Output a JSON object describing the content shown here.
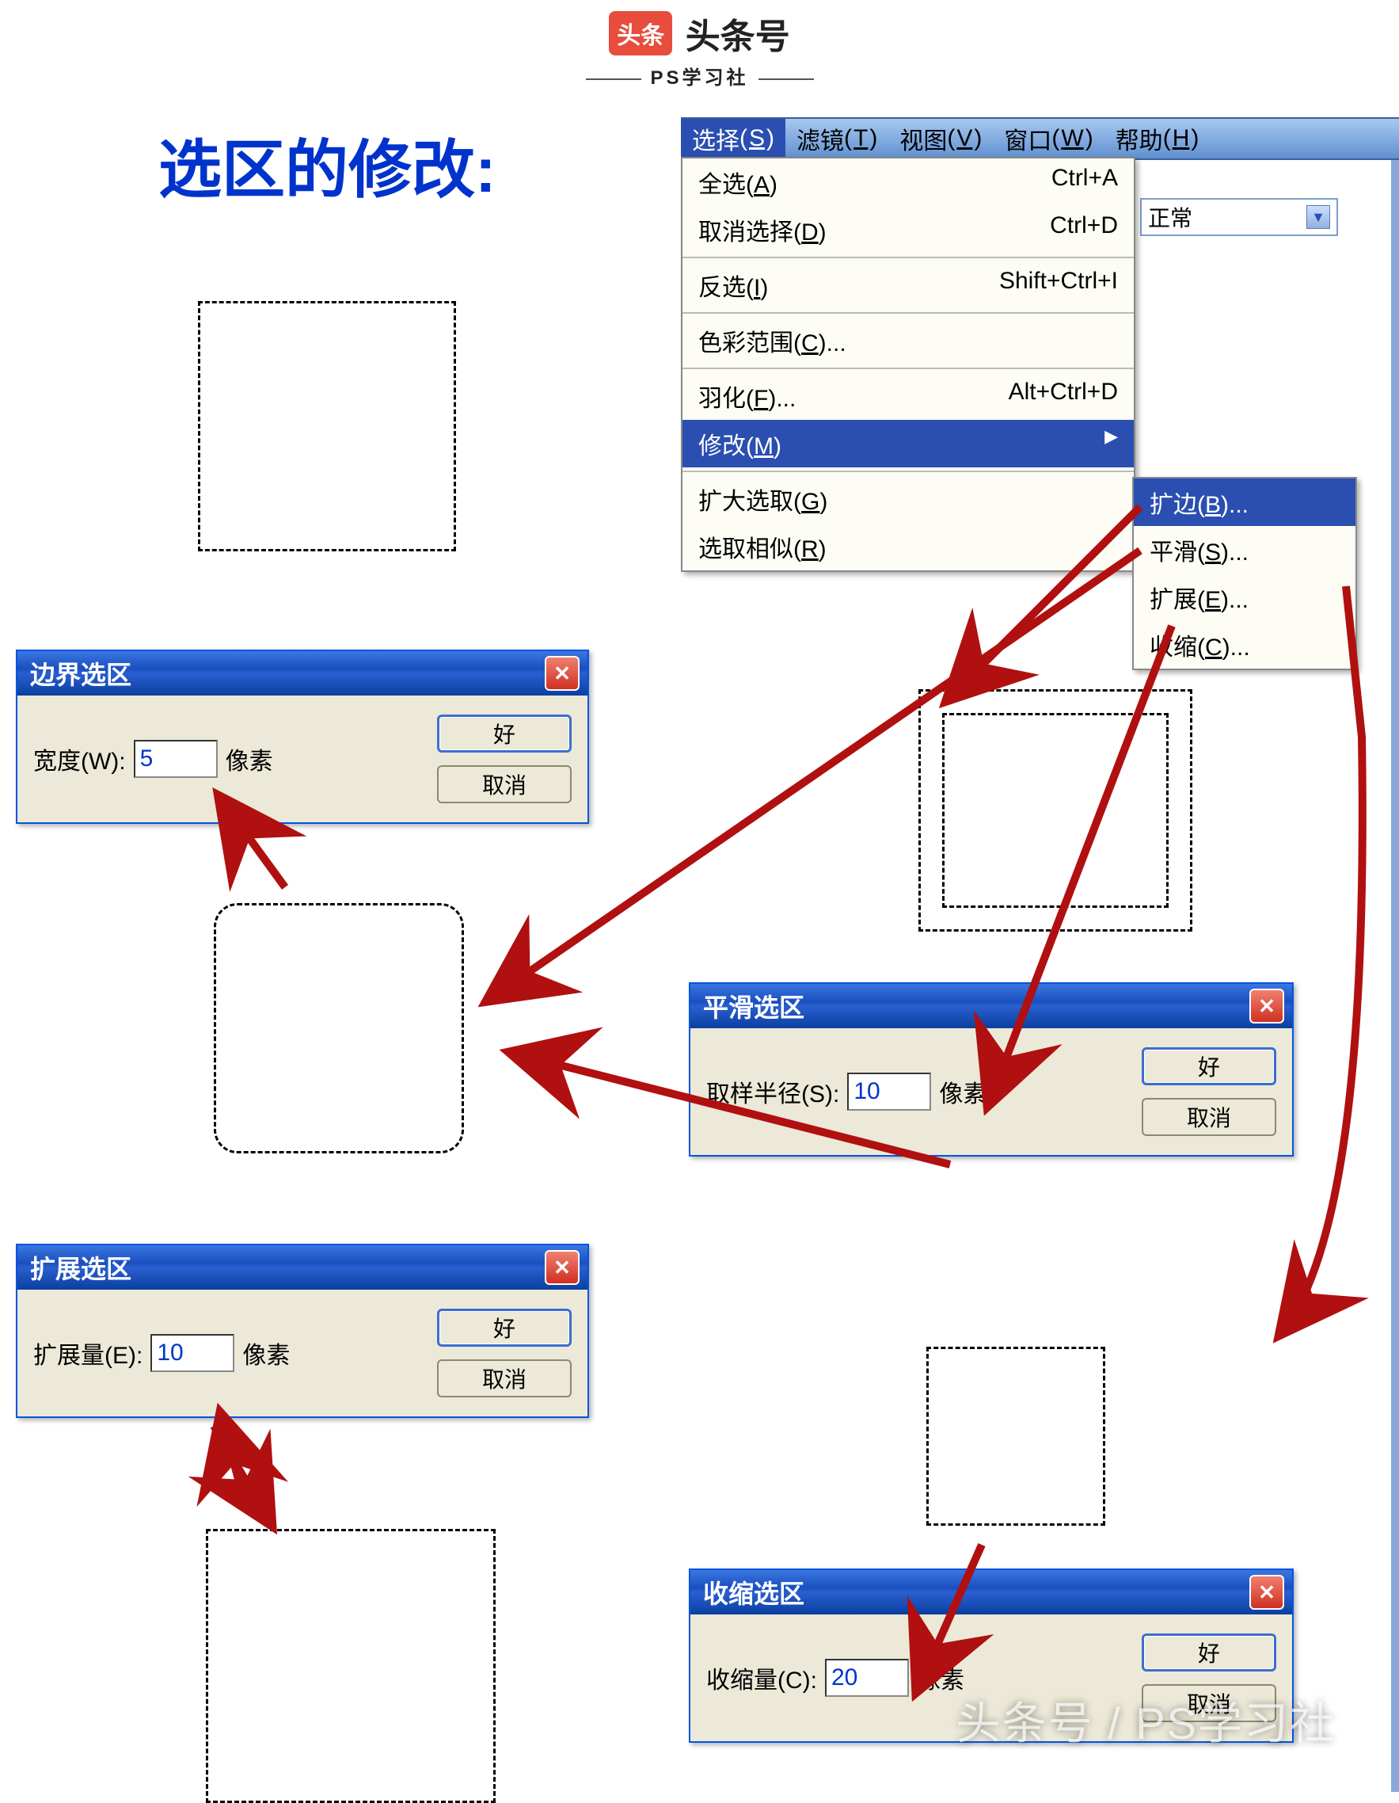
{
  "logo": {
    "badge": "头条",
    "text": "头条号",
    "sub": "PS学习社"
  },
  "page_title": "选区的修改:",
  "menubar": {
    "items": [
      {
        "label": "选择",
        "key": "S",
        "selected": true
      },
      {
        "label": "滤镜",
        "key": "T"
      },
      {
        "label": "视图",
        "key": "V"
      },
      {
        "label": "窗口",
        "key": "W"
      },
      {
        "label": "帮助",
        "key": "H"
      }
    ]
  },
  "tool_dropdown": {
    "value": "正常"
  },
  "dropdown": {
    "rows": [
      {
        "label": "全选",
        "key": "A",
        "shortcut": "Ctrl+A"
      },
      {
        "label": "取消选择",
        "key": "D",
        "shortcut": "Ctrl+D"
      },
      {
        "sep": true
      },
      {
        "label": "反选",
        "key": "I",
        "shortcut": "Shift+Ctrl+I"
      },
      {
        "sep": true
      },
      {
        "label": "色彩范围",
        "key": "C",
        "suffix": "..."
      },
      {
        "sep": true
      },
      {
        "label": "羽化",
        "key": "F",
        "suffix": "...",
        "shortcut": "Alt+Ctrl+D"
      },
      {
        "label": "修改",
        "key": "M",
        "selected": true,
        "arrow": true
      },
      {
        "sep": true
      },
      {
        "label": "扩大选取",
        "key": "G"
      },
      {
        "label": "选取相似",
        "key": "R"
      }
    ]
  },
  "submenu": {
    "rows": [
      {
        "label": "扩边",
        "key": "B",
        "suffix": "...",
        "selected": true
      },
      {
        "label": "平滑",
        "key": "S",
        "suffix": "..."
      },
      {
        "label": "扩展",
        "key": "E",
        "suffix": "..."
      },
      {
        "label": "收缩",
        "key": "C",
        "suffix": "..."
      }
    ]
  },
  "dialogs": {
    "border": {
      "title": "边界选区",
      "field_label": "宽度(W):",
      "value": "5",
      "unit": "像素",
      "ok": "好",
      "cancel": "取消"
    },
    "smooth": {
      "title": "平滑选区",
      "field_label": "取样半径(S):",
      "value": "10",
      "unit": "像素",
      "ok": "好",
      "cancel": "取消"
    },
    "expand": {
      "title": "扩展选区",
      "field_label": "扩展量(E):",
      "value": "10",
      "unit": "像素",
      "ok": "好",
      "cancel": "取消"
    },
    "contract": {
      "title": "收缩选区",
      "field_label": "收缩量(C):",
      "value": "20",
      "unit": "像素",
      "ok": "好",
      "cancel": "取消"
    }
  },
  "watermark": "头条号 / PS学习社"
}
